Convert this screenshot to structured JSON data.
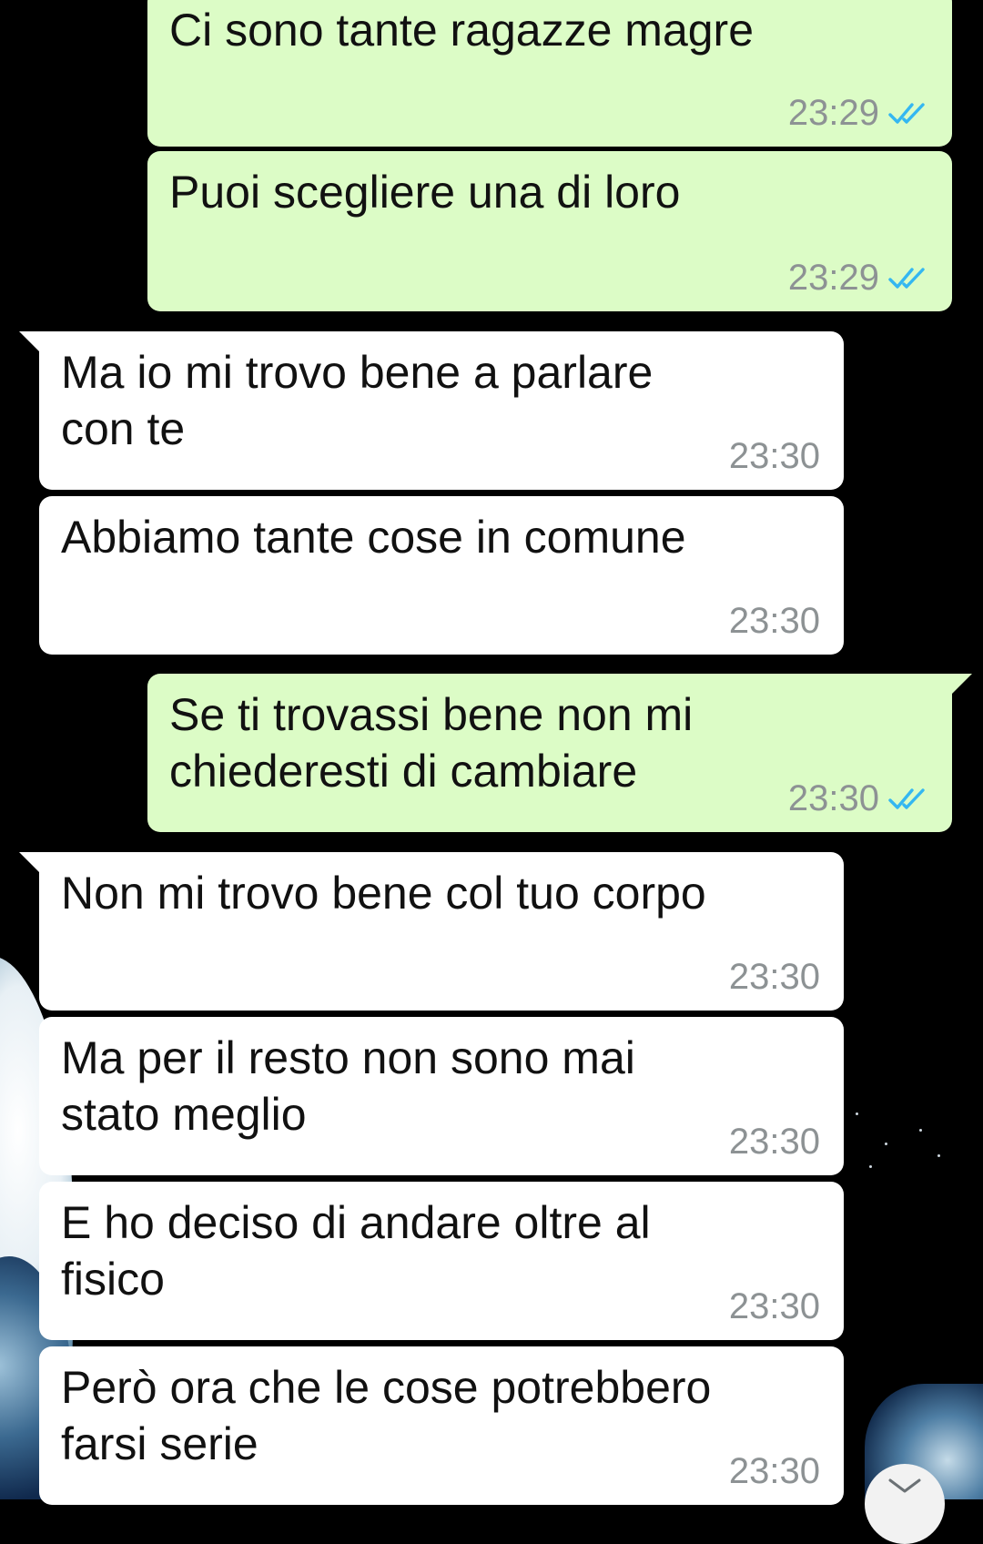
{
  "messages": [
    {
      "direction": "out",
      "text": "Ci sono tante ragazze magre",
      "time": "23:29",
      "read": true
    },
    {
      "direction": "out",
      "text": "Puoi scegliere una di loro",
      "time": "23:29",
      "read": true
    },
    {
      "direction": "in",
      "text": "Ma io mi trovo bene a parlare\ncon te",
      "time": "23:30"
    },
    {
      "direction": "in",
      "text": "Abbiamo tante cose in comune",
      "time": "23:30"
    },
    {
      "direction": "out",
      "text": "Se ti trovassi bene non mi\nchiederesti di cambiare",
      "time": "23:30",
      "read": true
    },
    {
      "direction": "in",
      "text": "Non mi trovo bene col tuo corpo",
      "time": "23:30"
    },
    {
      "direction": "in",
      "text": "Ma per il resto non sono mai\nstato meglio",
      "time": "23:30"
    },
    {
      "direction": "in",
      "text": "E ho deciso di andare oltre al\nfisico",
      "time": "23:30"
    },
    {
      "direction": "in",
      "text": "Però ora che le cose potrebbero\nfarsi serie",
      "time": "23:30"
    }
  ],
  "colors": {
    "outgoing_bubble": "#dcfcc6",
    "incoming_bubble": "#ffffff",
    "read_ticks": "#34b7f1",
    "timestamp": "#8d9294",
    "background": "#000000"
  },
  "icons": {
    "read_receipt": "double-check-icon",
    "scroll_down": "chevron-down-icon"
  }
}
